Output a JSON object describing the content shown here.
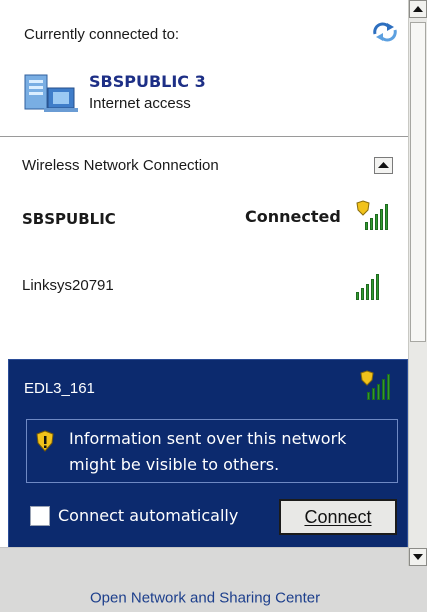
{
  "header": {
    "label": "Currently connected to:"
  },
  "current_network": {
    "name": "SBSPUBLIC 3",
    "status": "Internet access"
  },
  "section": {
    "title": "Wireless Network Connection"
  },
  "networks": [
    {
      "name": "SBSPUBLIC",
      "status": "Connected",
      "secured": true
    },
    {
      "name": "Linksys20791",
      "status": "",
      "secured": false
    }
  ],
  "selected_network": {
    "name": "EDL3_161",
    "warning": [
      "Information sent over this network",
      "might be visible to others."
    ],
    "connect_auto_label": "Connect automatically",
    "connect_auto_checked": false,
    "connect_button_label": "Connect"
  },
  "footer": {
    "link": "Open Network and Sharing Center"
  },
  "colors": {
    "selected_bg": "#0c2a6e",
    "signal": "#2f9a2f",
    "link": "#1d3f8c"
  }
}
